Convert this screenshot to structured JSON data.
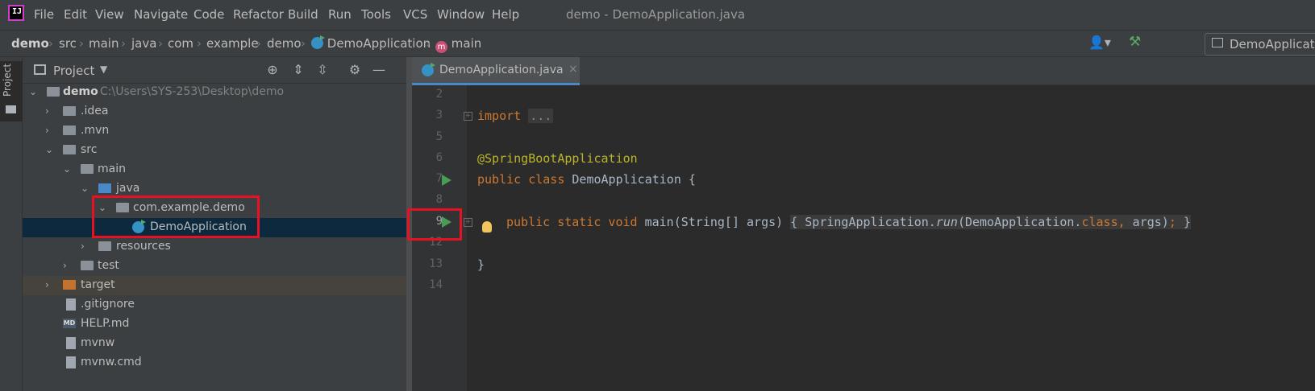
{
  "window": {
    "app_icon": "intellij-idea-icon",
    "logo_text": "IJ",
    "title": "demo - DemoApplication.java"
  },
  "menu": [
    "File",
    "Edit",
    "View",
    "Navigate",
    "Code",
    "Refactor",
    "Build",
    "Run",
    "Tools",
    "VCS",
    "Window",
    "Help"
  ],
  "breadcrumb": [
    "demo",
    "src",
    "main",
    "java",
    "com",
    "example",
    "demo",
    "DemoApplication",
    "main"
  ],
  "run_config": "DemoApplication",
  "tool_stripe": {
    "project_label": "Project"
  },
  "project_panel": {
    "title": "Project",
    "tree": [
      {
        "label": "demo",
        "path": "C:\\Users\\SYS-253\\Desktop\\demo",
        "expanded": true
      },
      {
        "label": ".idea"
      },
      {
        "label": ".mvn"
      },
      {
        "label": "src",
        "expanded": true
      },
      {
        "label": "main",
        "expanded": true
      },
      {
        "label": "java",
        "expanded": true
      },
      {
        "label": "com.example.demo",
        "expanded": true
      },
      {
        "label": "DemoApplication",
        "selected": true
      },
      {
        "label": "resources"
      },
      {
        "label": "test"
      },
      {
        "label": "target"
      },
      {
        "label": ".gitignore"
      },
      {
        "label": "HELP.md"
      },
      {
        "label": "mvnw"
      },
      {
        "label": "mvnw.cmd"
      }
    ]
  },
  "editor": {
    "tab": "DemoApplication.java",
    "lines": [
      {
        "number": "2",
        "code": ""
      },
      {
        "number": "3",
        "code": "import ..."
      },
      {
        "number": "5",
        "code": ""
      },
      {
        "number": "6",
        "code": "@SpringBootApplication"
      },
      {
        "number": "7",
        "code": "public class DemoApplication {"
      },
      {
        "number": "8",
        "code": ""
      },
      {
        "number": "9",
        "code": "    public static void main(String[] args) { SpringApplication.run(DemoApplication.class, args); }"
      },
      {
        "number": "12",
        "code": ""
      },
      {
        "number": "13",
        "code": "}"
      },
      {
        "number": "14",
        "code": ""
      }
    ]
  },
  "colors": {
    "keyword": "#cc7832",
    "annotation": "#bbb529",
    "run_gutter": "#499c54",
    "highlight_box": "#e81123",
    "selection": "#0d293e"
  }
}
